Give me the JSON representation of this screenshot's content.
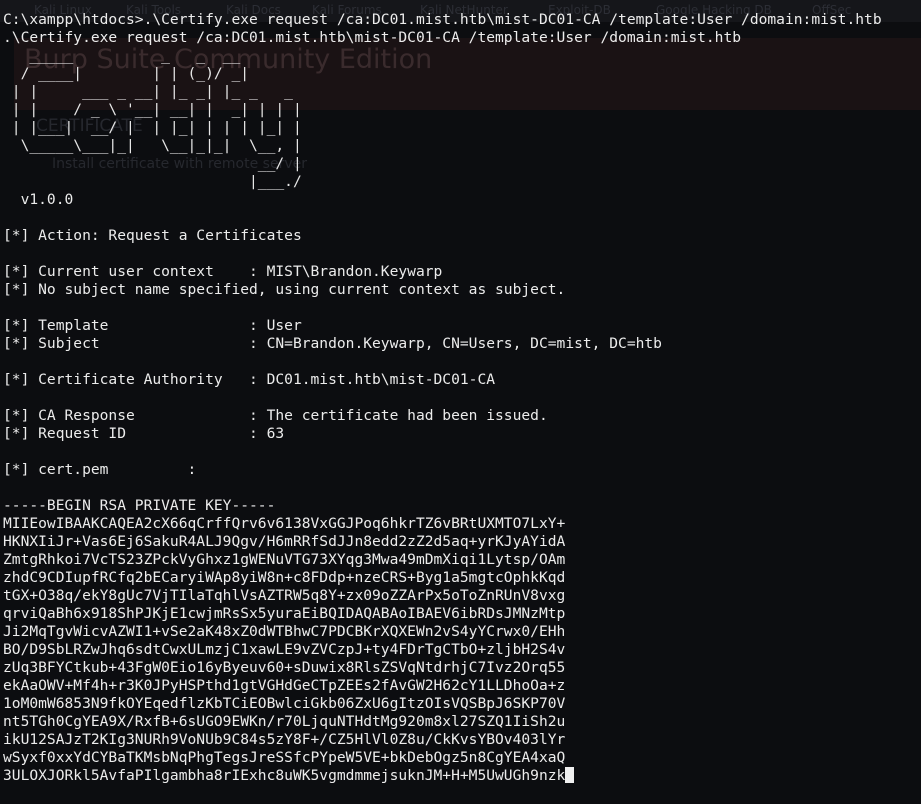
{
  "background_window": {
    "tabs": [
      "Kali Linux",
      "Kali Tools",
      "Kali Docs",
      "Kali Forums",
      "Kali NetHunter",
      "Exploit-DB",
      "Google Hacking DB",
      "OffSec"
    ],
    "title": "Burp Suite Community Edition",
    "subtitle": "CERTIFICATE",
    "caption": "Install certificate with remote server"
  },
  "terminal": {
    "command_echo": "C:\\xampp\\htdocs>.\\Certify.exe request /ca:DC01.mist.htb\\mist-DC01-CA /template:User /domain:mist.htb",
    "command_line": ".\\Certify.exe request /ca:DC01.mist.htb\\mist-DC01-CA /template:User /domain:mist.htb",
    "banner": [
      "   _____          _   _  __",
      "  / ____|        | | (_)/ _|",
      " | |     ___ _ __| |_ _| |_ _   _",
      " | |    / _ \\ '__| __| |  _| | | |",
      " | |___|  __/ |  | |_| | | | |_| |",
      "  \\_____\\___|_|   \\__|_|_|  \\__, |",
      "                             __/ |",
      "                            |___./"
    ],
    "version": "  v1.0.0",
    "output_lines": [
      "",
      "[*] Action: Request a Certificates",
      "",
      "[*] Current user context    : MIST\\Brandon.Keywarp",
      "[*] No subject name specified, using current context as subject.",
      "",
      "[*] Template                : User",
      "[*] Subject                 : CN=Brandon.Keywarp, CN=Users, DC=mist, DC=htb",
      "",
      "[*] Certificate Authority   : DC01.mist.htb\\mist-DC01-CA",
      "",
      "[*] CA Response             : The certificate had been issued.",
      "[*] Request ID              : 63",
      "",
      "[*] cert.pem         :",
      "",
      "-----BEGIN RSA PRIVATE KEY-----",
      "MIIEowIBAAKCAQEA2cX66qCrffQrv6v6138VxGGJPoq6hkrTZ6vBRtUXMTO7LxY+",
      "HKNXIiJr+Vas6Ej6SakuR4ALJ9Qgv/H6mRRfSdJJn8edd2zZ2d5aq+yrKJyAYidA",
      "ZmtgRhkoi7VcTS23ZPckVyGhxz1gWENuVTG73XYqg3Mwa49mDmXiqi1Lytsp/OAm",
      "zhdC9CDIupfRCfq2bECaryiWAp8yiW8n+c8FDdp+nzeCRS+Byg1a5mgtcOphkKqd",
      "tGX+O38q/ekY8gUc7VjTIlaTqhlVsAZTRW5q8Y+zx09oZZArPx5oToZnRUnV8vxg",
      "qrviQaBh6x918ShPJKjE1cwjmRsSx5yuraEiBQIDAQABAoIBAEV6ibRDsJMNzMtp",
      "Ji2MqTgvWicvAZWI1+vSe2aK48xZ0dWTBhwC7PDCBKrXQXEWn2vS4yYCrwx0/EHh",
      "BO/D9SbLRZwJhq6sdtCwxULmzjC1xawLE9vZVCzpJ+ty4FDrTgCTbO+zljbH2S4v",
      "zUq3BFYCtkub+43FgW0Eio16yByeuv60+sDuwix8RlsZSVqNtdrhjC7Ivz2Orq55",
      "ekAaOWV+Mf4h+r3K0JPyHSPthd1gtVGHdGeCTpZEEs2fAvGW2H62cY1LLDhoOa+z",
      "1oM0mW6853N9fkOYEqedflzKbTCiEOBwlciGkb06ZxU6gItzOIsVQSBpJ6SKP70V",
      "nt5TGh0CgYEA9X/RxfB+6sUGO9EWKn/r70LjquNTHdtMg920m8xl27SZQ1IiSh2u",
      "ikU12SAJzT2KIg3NURh9VoNUb9C84s5zY8F+/CZ5HlVl0Z8u/CkKvsYBOv403lYr",
      "wSyxf0xxYdCYBaTKMsbNqPhgTegsJreSSfcPYpeW5VE+bkDebOgz5n8CgYEA4xaQ",
      "3ULOXJORkl5AvfaPIlgambha8rIExhc8uWK5vgmdmmejsuknJM+H+M5UwUGh9nzk"
    ]
  }
}
